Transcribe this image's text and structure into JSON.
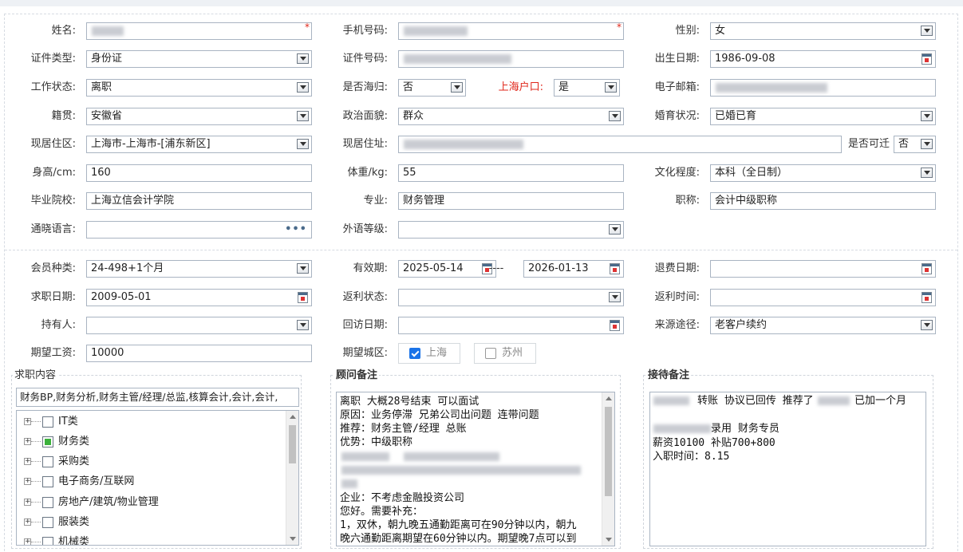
{
  "form": {
    "name_label": "姓名:",
    "phone_label": "手机号码:",
    "gender_label": "性别:",
    "gender_value": "女",
    "id_type_label": "证件类型:",
    "id_type_value": "身份证",
    "id_no_label": "证件号码:",
    "birth_label": "出生日期:",
    "birth_value": "1986-09-08",
    "work_status_label": "工作状态:",
    "work_status_value": "离职",
    "overseas_label": "是否海归:",
    "overseas_value": "否",
    "hukou_label": "上海户口:",
    "hukou_value": "是",
    "email_label": "电子邮箱:",
    "native_label": "籍贯:",
    "native_value": "安徽省",
    "political_label": "政治面貌:",
    "political_value": "群众",
    "marital_label": "婚育状况:",
    "marital_value": "已婚已育",
    "residence_label": "现居住区:",
    "residence_value": "上海市-上海市-[浦东新区]",
    "address_label": "现居住址:",
    "relocate_label": "是否可迁",
    "relocate_value": "否",
    "height_label": "身高/cm:",
    "height_value": "160",
    "weight_label": "体重/kg:",
    "weight_value": "55",
    "education_label": "文化程度:",
    "education_value": "本科（全日制）",
    "school_label": "毕业院校:",
    "school_value": "上海立信会计学院",
    "major_label": "专业:",
    "major_value": "财务管理",
    "title_label": "职称:",
    "title_value": "会计中级职称",
    "language_label": "通晓语言:",
    "foreign_level_label": "外语等级:"
  },
  "membership": {
    "type_label": "会员种类:",
    "type_value": "24-498+1个月",
    "valid_label": "有效期:",
    "valid_from": "2025-05-14",
    "valid_sep": "----",
    "valid_to": "2026-01-13",
    "refund_date_label": "退费日期:",
    "job_date_label": "求职日期:",
    "job_date_value": "2009-05-01",
    "rebate_status_label": "返利状态:",
    "rebate_time_label": "返利时间:",
    "holder_label": "持有人:",
    "visit_date_label": "回访日期:",
    "source_label": "来源途径:",
    "source_value": "老客户续约",
    "salary_label": "期望工资:",
    "salary_value": "10000",
    "city_label": "期望城区:",
    "cities": [
      {
        "label": "上海",
        "checked": true
      },
      {
        "label": "苏州",
        "checked": false
      }
    ]
  },
  "job_content": {
    "title": "求职内容",
    "summary": "财务BP,财务分析,财务主管/经理/总监,核算会计,会计,会计,",
    "tree": [
      {
        "label": "IT类",
        "state": "none"
      },
      {
        "label": "财务类",
        "state": "partial"
      },
      {
        "label": "采购类",
        "state": "none"
      },
      {
        "label": "电子商务/互联网",
        "state": "none"
      },
      {
        "label": "房地产/建筑/物业管理",
        "state": "none"
      },
      {
        "label": "服装类",
        "state": "none"
      },
      {
        "label": "机械类",
        "state": "none"
      }
    ]
  },
  "consultant_note": {
    "title": "顾问备注",
    "lines": [
      "离职  大概28号结束    可以面试",
      "原因：业务停滞    兄弟公司出问题 连带问题",
      "推荐：财务主管/经理   总账",
      "优势：中级职称",
      "",
      "",
      "",
      "企业：不考虑金融投资公司",
      "您好。需要补充：",
      "1，双休，朝九晚五通勤距离可在90分钟以内，朝九",
      "晚六通勤距离期望在60分钟以内。期望晚7点可以到"
    ]
  },
  "reception_note": {
    "title": "接待备注",
    "line1_a": "转账 协议已回传 推荐了",
    "line1_b": "已加一个月",
    "line3": "录用 财务专员",
    "line4": "薪资10100  补贴700+800",
    "line5": "入职时间：8.15"
  },
  "icons": {
    "dropdown": "dropdown-arrow-icon",
    "calendar": "calendar-icon",
    "ellipsis": "ellipsis-icon"
  },
  "colors": {
    "required": "#e0261a",
    "hukou_label": "#e0261a",
    "checkbox_on": "#1a73e8",
    "tree_partial": "#3cb13c"
  }
}
